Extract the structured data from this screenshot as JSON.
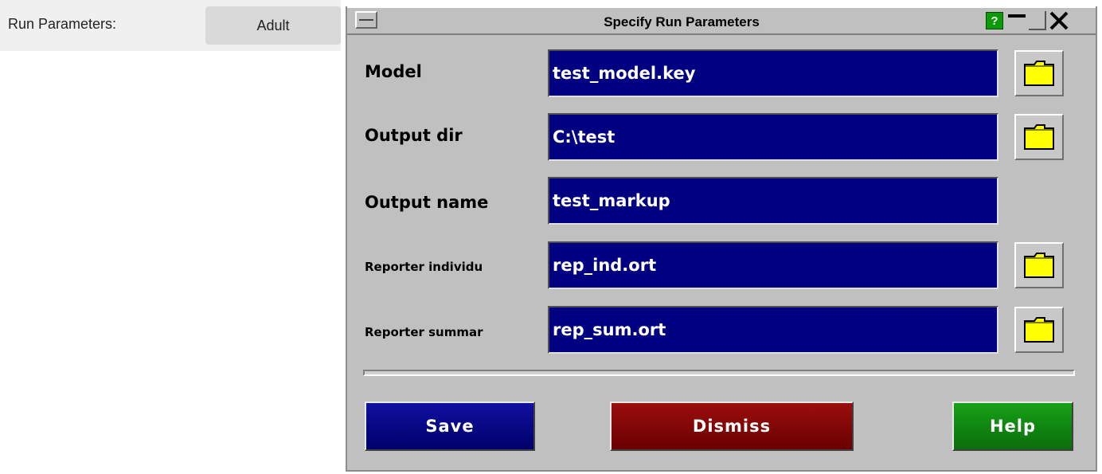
{
  "background_panel": {
    "label": "Run Parameters:",
    "button_label": "Adult"
  },
  "dialog": {
    "title": "Specify Run Parameters",
    "titlebar_help_label": "?",
    "rows": [
      {
        "label": "Model",
        "value": "test_model.key",
        "has_browse": true
      },
      {
        "label": "Output dir",
        "value": "C:\\test",
        "has_browse": true
      },
      {
        "label": "Output name",
        "value": "test_markup",
        "has_browse": false
      },
      {
        "label": "Reporter individu",
        "value": "rep_ind.ort",
        "has_browse": true
      },
      {
        "label": "Reporter summar",
        "value": "rep_sum.ort",
        "has_browse": true
      }
    ],
    "buttons": {
      "save": "Save",
      "dismiss": "Dismiss",
      "help": "Help"
    }
  },
  "colors": {
    "field_bg": "#000080",
    "save": "#000080",
    "dismiss": "#800000",
    "help": "#008000",
    "folder": "#ffff00",
    "dialog_bg": "#c0c0c0"
  },
  "icons": {
    "browse": "folder-icon",
    "window_menu": "window-menu-icon",
    "minimize": "minimize-icon",
    "maximize": "maximize-icon",
    "close": "close-icon"
  }
}
